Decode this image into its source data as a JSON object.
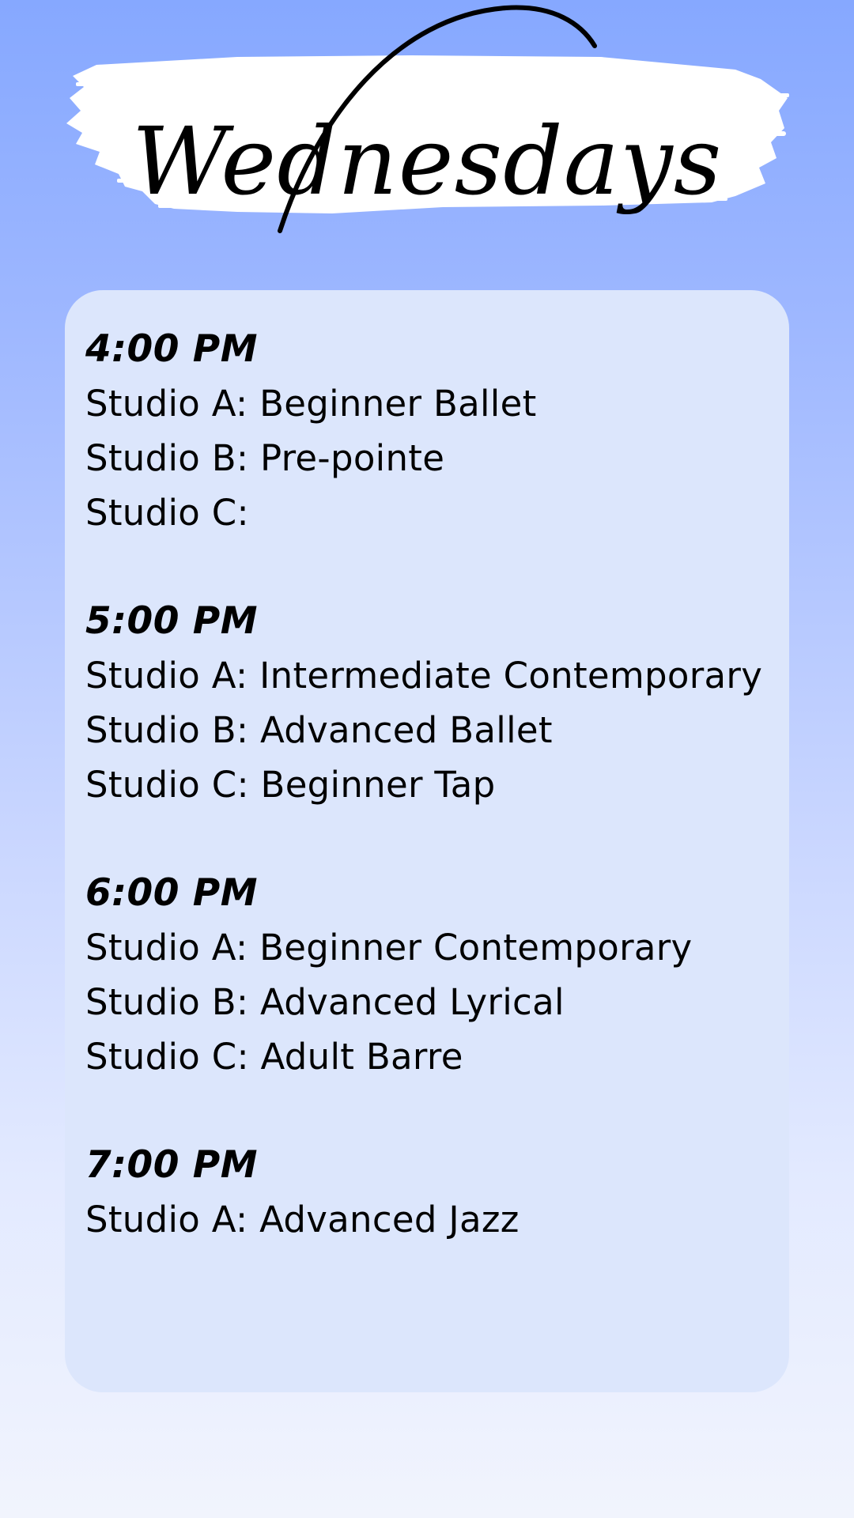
{
  "title": "Wednesdays",
  "colors": {
    "background_top": "#86a8ff",
    "background_bottom": "#f1f4fd",
    "card": "#dce6fc",
    "brush_stroke": "#ffffff",
    "text": "#000000"
  },
  "schedule": [
    {
      "time": "4:00 PM",
      "classes": [
        "Studio A: Beginner Ballet",
        "Studio B: Pre-pointe",
        "Studio C:"
      ]
    },
    {
      "time": "5:00 PM",
      "classes": [
        "Studio A: Intermediate Contemporary",
        "Studio B: Advanced Ballet",
        "Studio C: Beginner Tap"
      ]
    },
    {
      "time": "6:00 PM",
      "classes": [
        "Studio A: Beginner Contemporary",
        "Studio B: Advanced Lyrical",
        "Studio C: Adult Barre"
      ]
    },
    {
      "time": "7:00 PM",
      "classes": [
        "Studio A: Advanced Jazz"
      ]
    }
  ]
}
